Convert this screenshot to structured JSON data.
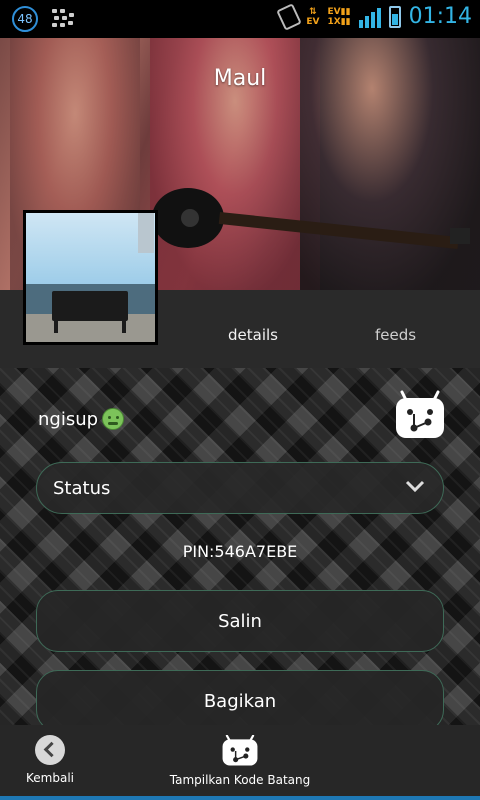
{
  "status_bar": {
    "notification_count": "48",
    "time": "01:14",
    "network_label_top": "EV",
    "network_label_bottom": "1X",
    "data_indicator": "EV"
  },
  "profile": {
    "name": "Maul",
    "status_message": "ngisup",
    "status_dropdown_label": "Status",
    "pin": "PIN:546A7EBE"
  },
  "tabs": [
    {
      "label": "details"
    },
    {
      "label": "feeds"
    }
  ],
  "actions": {
    "copy_label": "Salin",
    "share_label": "Bagikan"
  },
  "bottom_bar": {
    "back_label": "Kembali",
    "barcode_label": "Tampilkan Kode Batang"
  },
  "colors": {
    "accent": "#33b5e5",
    "button_border": "#3e6a57",
    "bottom_bar_line": "#1e78b4"
  }
}
